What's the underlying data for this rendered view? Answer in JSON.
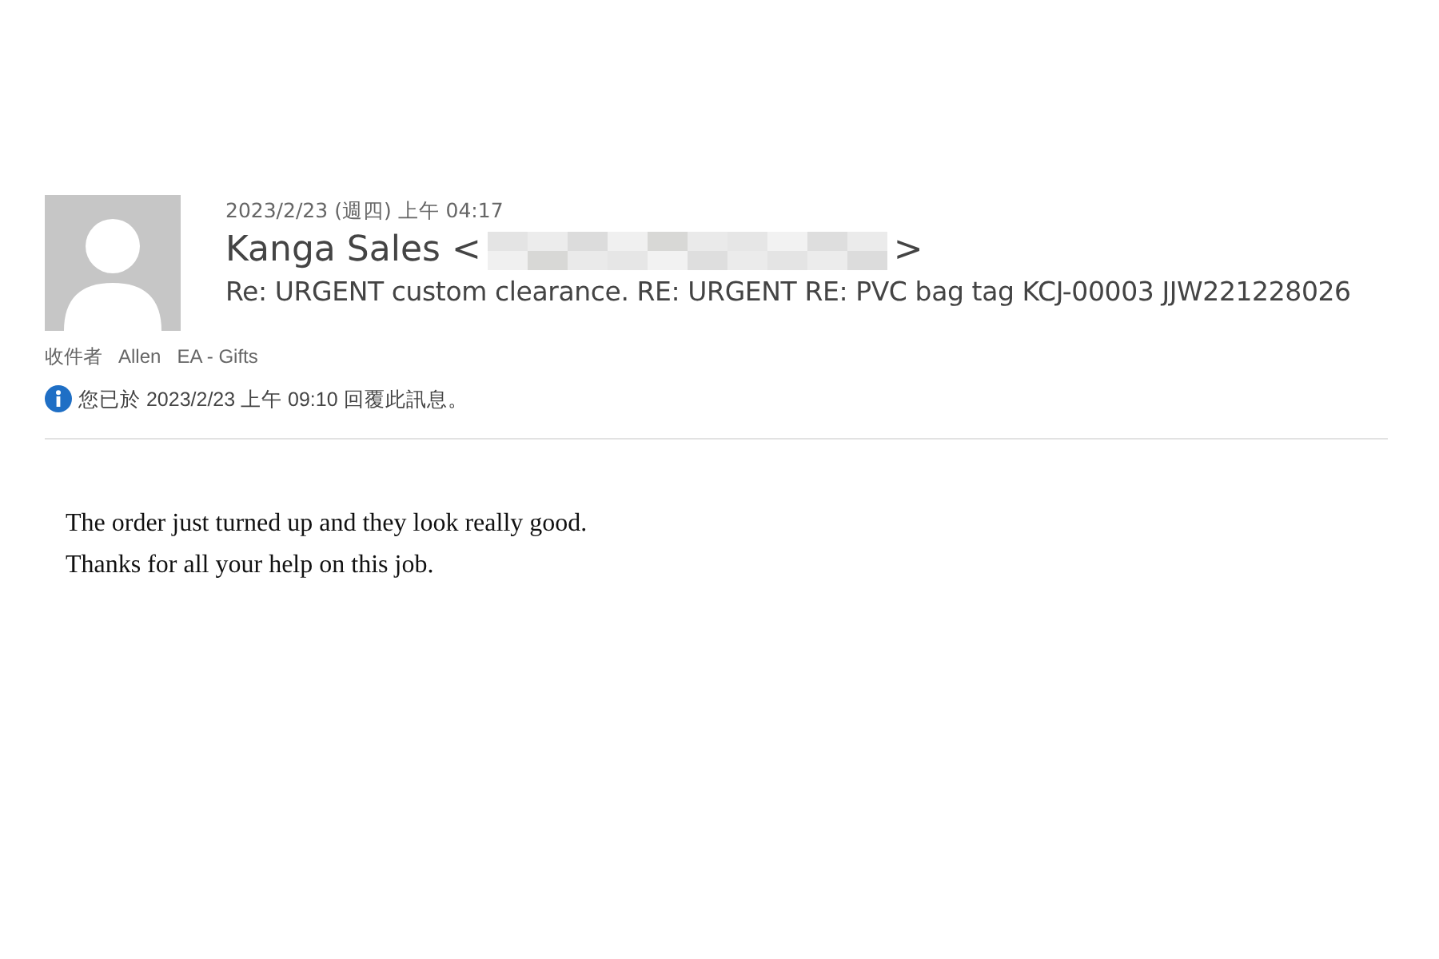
{
  "message": {
    "date": "2023/2/23 (週四) 上午 04:17",
    "sender": {
      "name": "Kanga Sales <",
      "address_redacted": true,
      "closing": ">"
    },
    "subject": "Re: URGENT custom clearance. RE: URGENT RE: PVC bag tag KCJ-00003 JJW221228026",
    "recipients": {
      "label": "收件者",
      "names": [
        "Allen",
        "EA - Gifts"
      ]
    },
    "info": "您已於 2023/2/23 上午 09:10 回覆此訊息。",
    "body": [
      "The order just turned up and they look really good.",
      "Thanks for all your help on this job."
    ]
  }
}
